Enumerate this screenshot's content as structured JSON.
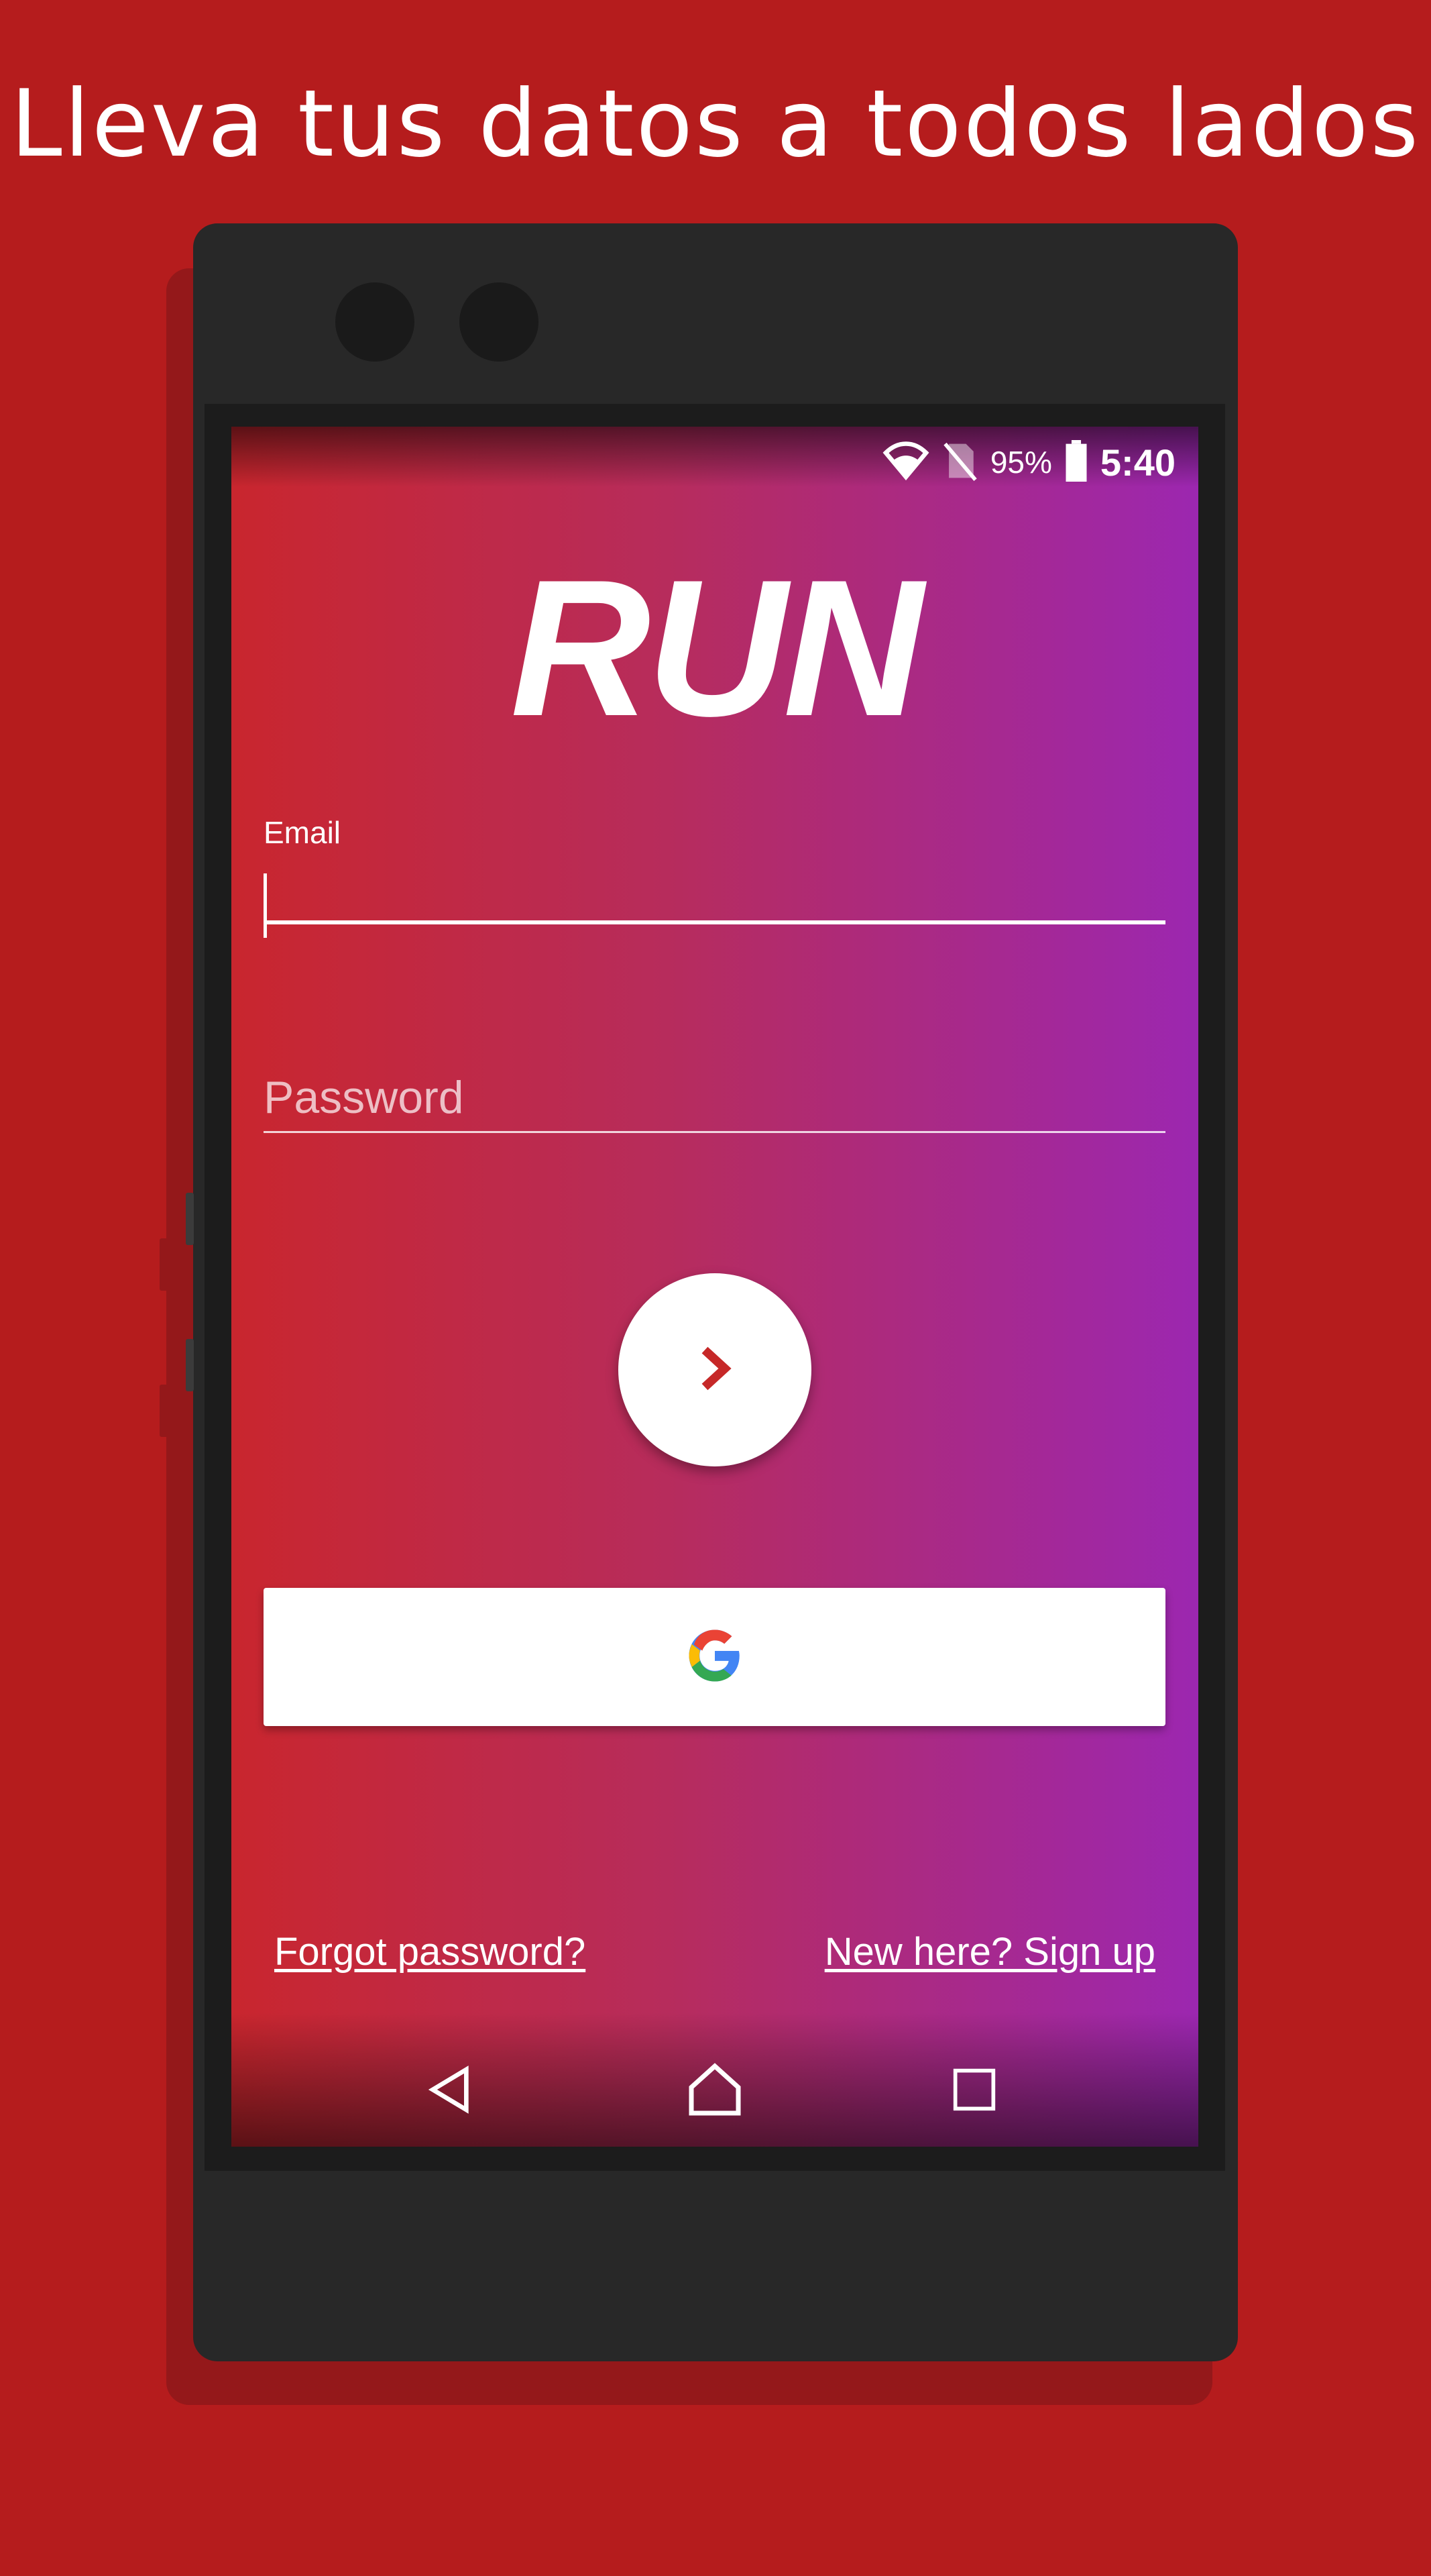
{
  "headline": "Lleva tus datos a todos lados",
  "status_bar": {
    "battery_percent": "95%",
    "time": "5:40",
    "icons": [
      "wifi-icon",
      "no-sim-icon",
      "battery-icon"
    ]
  },
  "app": {
    "logo_text": "RUN",
    "email": {
      "label": "Email",
      "value": ""
    },
    "password": {
      "placeholder": "Password",
      "value": ""
    },
    "next_button": {
      "icon": "chevron-right-icon",
      "color": "#c62828"
    },
    "google_button": {
      "icon": "google-icon"
    },
    "links": {
      "forgot_password": "Forgot password?",
      "sign_up": "New here? Sign up"
    }
  },
  "nav_bar": {
    "items": [
      "back-icon",
      "home-icon",
      "recents-icon"
    ]
  },
  "colors": {
    "background": "#b51c1d",
    "gradient_start": "#c9262e",
    "gradient_end": "#9c27b0",
    "phone_body": "#282828"
  }
}
